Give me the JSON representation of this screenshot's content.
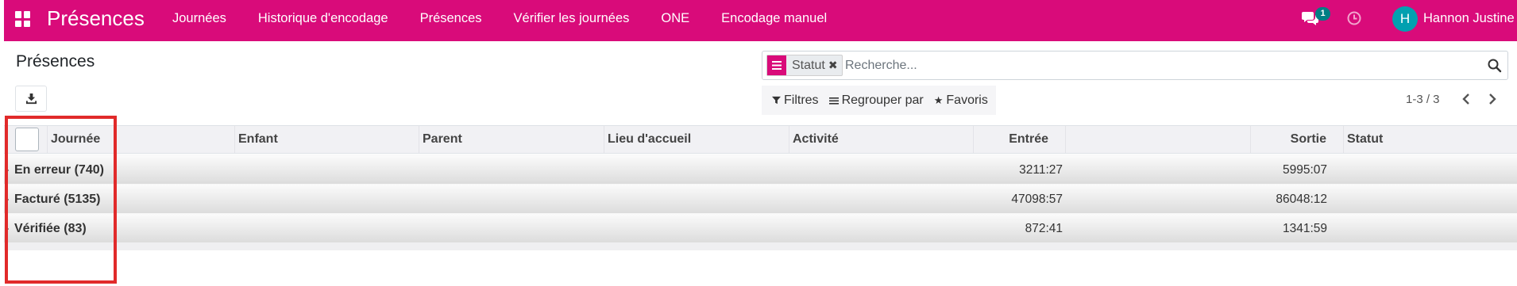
{
  "colors": {
    "brand": "#d90b7a",
    "badge": "#017e84",
    "avatar": "#01a0b0",
    "highlight": "#e12a2a"
  },
  "navbar": {
    "apps_icon": "grid-icon",
    "brand": "Présences",
    "menu": [
      "Journées",
      "Historique d'encodage",
      "Présences",
      "Vérifier les journées",
      "ONE",
      "Encodage manuel"
    ],
    "messages_icon": "chat-icon",
    "messages_badge": "1",
    "activity_icon": "clock-icon",
    "avatar_initial": "H",
    "user_name": "Hannon Justine"
  },
  "control_panel": {
    "title": "Présences",
    "download_icon": "download-icon",
    "search": {
      "facet_label": "Statut",
      "facet_icon": "group-by-icon",
      "placeholder": "Recherche...",
      "search_icon": "search-icon"
    },
    "filters": [
      {
        "label": "Filtres",
        "icon": "filter-icon"
      },
      {
        "label": "Regrouper par",
        "icon": "list-icon"
      },
      {
        "label": "Favoris",
        "icon": "star-icon"
      }
    ],
    "pager": {
      "value": "1-3 / 3",
      "prev_icon": "chevron-left-icon",
      "next_icon": "chevron-right-icon"
    }
  },
  "table": {
    "columns": [
      "Journée",
      "Enfant",
      "Parent",
      "Lieu d'accueil",
      "Activité",
      "Entrée",
      "Sortie",
      "Statut"
    ],
    "groups": [
      {
        "name": "En erreur (740)",
        "entree": "3211:27",
        "sortie": "5995:07"
      },
      {
        "name": "Facturé (5135)",
        "entree": "47098:57",
        "sortie": "86048:12"
      },
      {
        "name": "Vérifiée (83)",
        "entree": "872:41",
        "sortie": "1341:59"
      }
    ]
  }
}
